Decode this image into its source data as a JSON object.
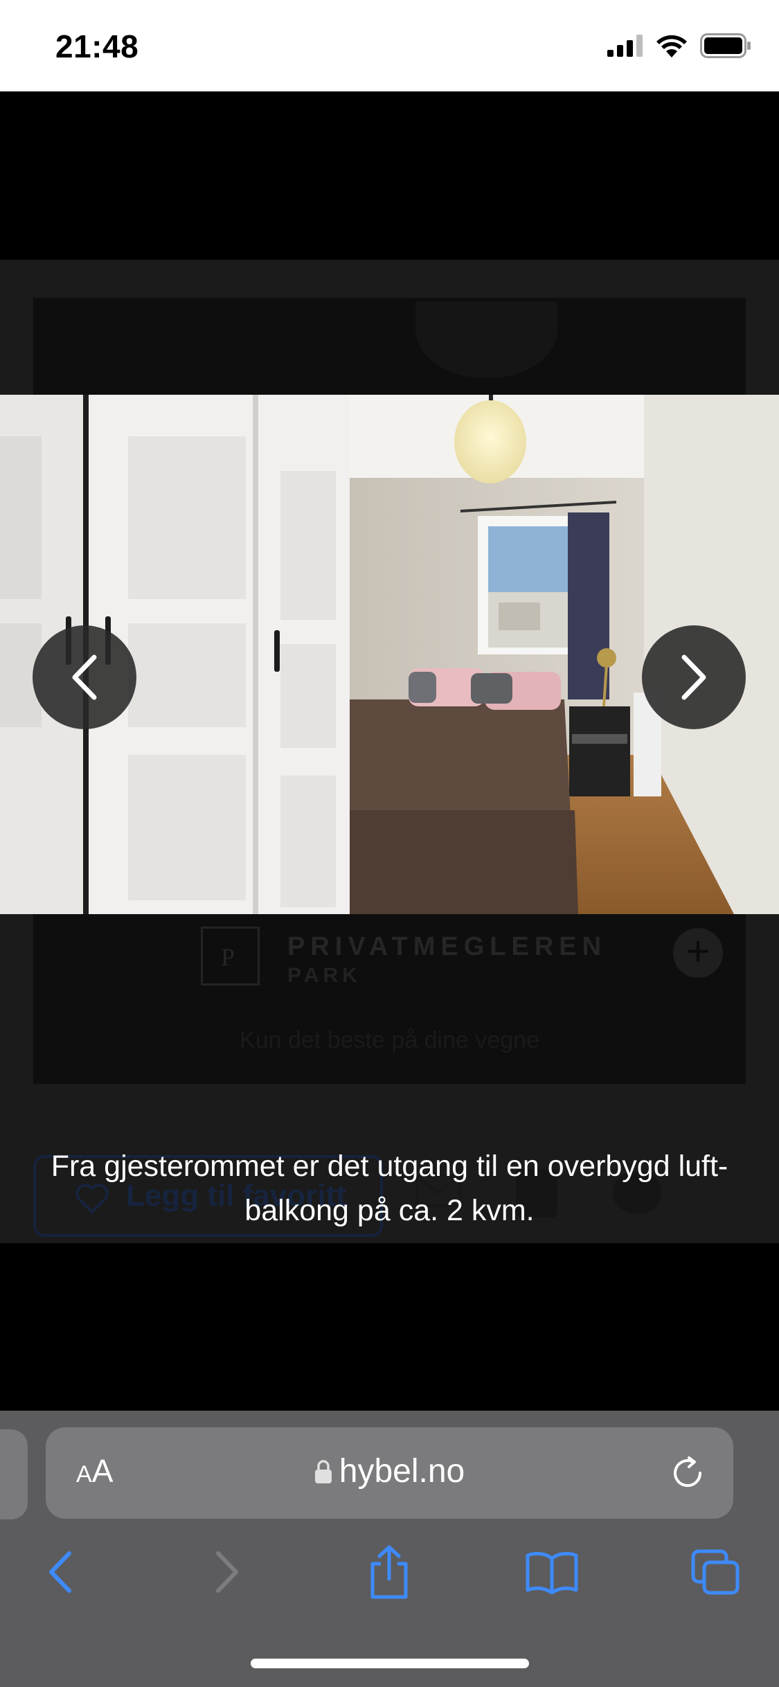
{
  "status_bar": {
    "time": "21:48",
    "icons": [
      "cellular-signal-icon",
      "wifi-icon",
      "battery-icon"
    ]
  },
  "background_page": {
    "brand_logo_letter": "P",
    "brand_name": "PRIVATMEGLEREN",
    "brand_sub": "PARK",
    "tagline": "Kun det beste på dine vegne",
    "favorite_button": "Legg til favoritt",
    "share_icons": [
      "mail-icon",
      "facebook-icon",
      "twitter-icon"
    ]
  },
  "gallery": {
    "photo_subject": "bedroom-photo",
    "prev_icon": "chevron-left-icon",
    "next_icon": "chevron-right-icon",
    "caption": "Fra gjesterommet er det utgang til en overbygd luft-balkong på ca. 2 kvm."
  },
  "safari": {
    "reader_label_small": "A",
    "reader_label_large": "A",
    "url": "hybel.no",
    "lock_icon": "lock-icon",
    "reload_icon": "reload-icon",
    "toolbar": [
      "back-icon",
      "forward-icon",
      "share-icon",
      "bookmarks-icon",
      "tabs-icon"
    ]
  },
  "colors": {
    "accent": "#3d8bfd",
    "toolbar_bg": "#5c5c5e",
    "address_bg": "#7b7b7d"
  }
}
